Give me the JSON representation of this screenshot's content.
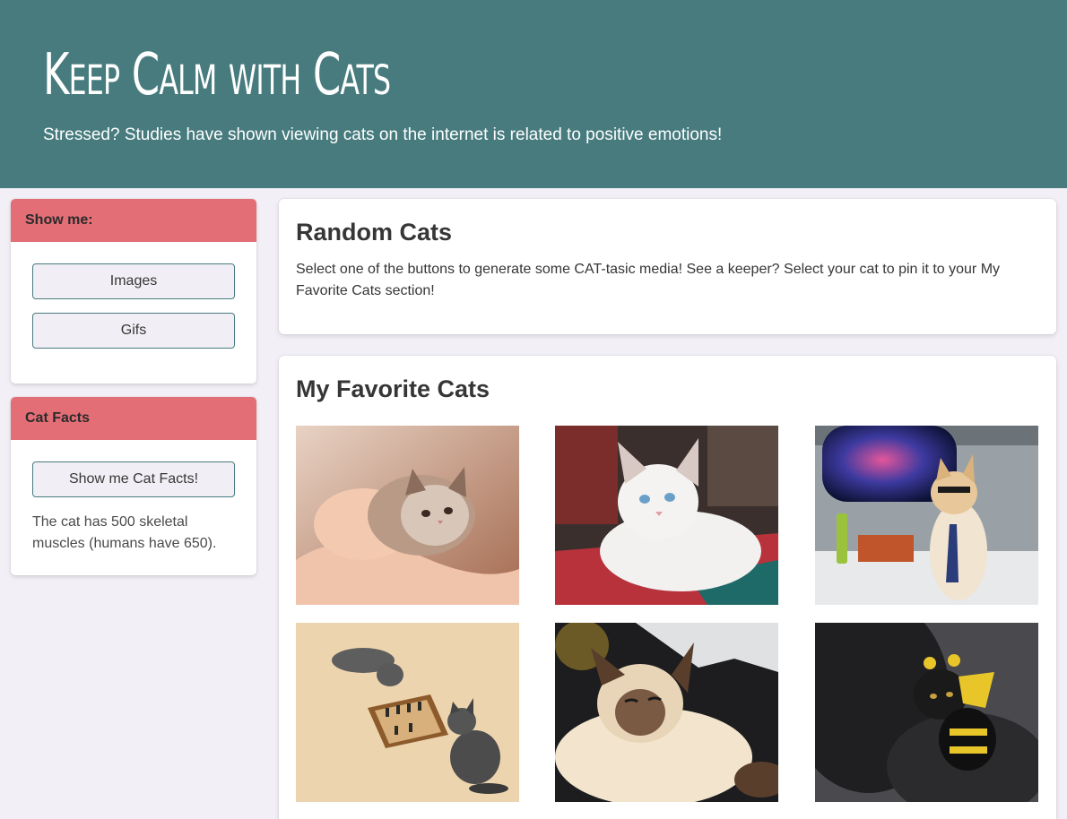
{
  "hero": {
    "title": "Keep Calm with Cats",
    "subtitle": "Stressed? Studies have shown viewing cats on the internet is related to positive emotions!"
  },
  "show_me": {
    "heading": "Show me:",
    "images_label": "Images",
    "gifs_label": "Gifs"
  },
  "cat_facts": {
    "heading": "Cat Facts",
    "button_label": "Show me Cat Facts!",
    "fact": "The cat has 500 skeletal muscles (humans have 650)."
  },
  "random_cats": {
    "title": "Random Cats",
    "text": "Select one of the buttons to generate some CAT-tasic media! See a keeper? Select your cat to pin it to your My Favorite Cats section!"
  },
  "favorites": {
    "title": "My Favorite Cats",
    "images": [
      {
        "icon": "kitten-in-hand-photo"
      },
      {
        "icon": "white-cat-lying-photo"
      },
      {
        "icon": "cat-in-tie-space-window-photo"
      },
      {
        "icon": "kittens-playing-chess-photo"
      },
      {
        "icon": "siamese-cat-relaxing-photo"
      },
      {
        "icon": "cat-in-bee-costume-photo"
      }
    ]
  },
  "colors": {
    "hero_bg": "#477b7e",
    "panel_heading_bg": "#e36e76",
    "page_bg": "#f2eff6"
  }
}
